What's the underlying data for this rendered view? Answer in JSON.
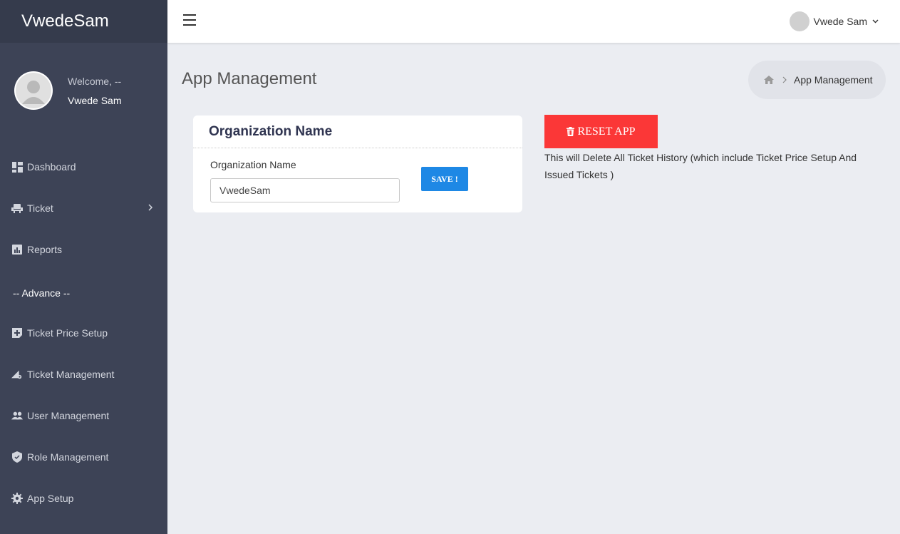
{
  "brand": "VwedeSam",
  "profile": {
    "welcome": "Welcome, --",
    "name": "Vwede Sam"
  },
  "sidebar": {
    "items": [
      {
        "label": "Dashboard",
        "icon": "dashboard-icon"
      },
      {
        "label": "Ticket",
        "icon": "ticket-icon"
      },
      {
        "label": "Reports",
        "icon": "reports-icon"
      },
      {
        "label": "Ticket Price Setup",
        "icon": "price-setup-icon"
      },
      {
        "label": "Ticket Management",
        "icon": "ticket-management-icon"
      },
      {
        "label": "User Management",
        "icon": "users-icon"
      },
      {
        "label": "Role Management",
        "icon": "shield-icon"
      },
      {
        "label": "App Setup",
        "icon": "gear-icon"
      }
    ],
    "section_advance": "-- Advance --"
  },
  "topbar": {
    "user_name": "Vwede Sam"
  },
  "page": {
    "title": "App Management",
    "breadcrumb": {
      "current": "App Management"
    }
  },
  "org_card": {
    "title": "Organization Name",
    "field_label": "Organization Name",
    "field_value": "VwedeSam",
    "save_label": "SAVE !"
  },
  "reset": {
    "label": "RESET APP",
    "note": "This will Delete All Ticket History (which include Ticket Price Setup And Issued Tickets )"
  },
  "colors": {
    "sidebar_bg": "#3d4356",
    "brand_bg": "#353b4c",
    "save_button": "#1e88e5",
    "reset_button": "#fb3737"
  }
}
